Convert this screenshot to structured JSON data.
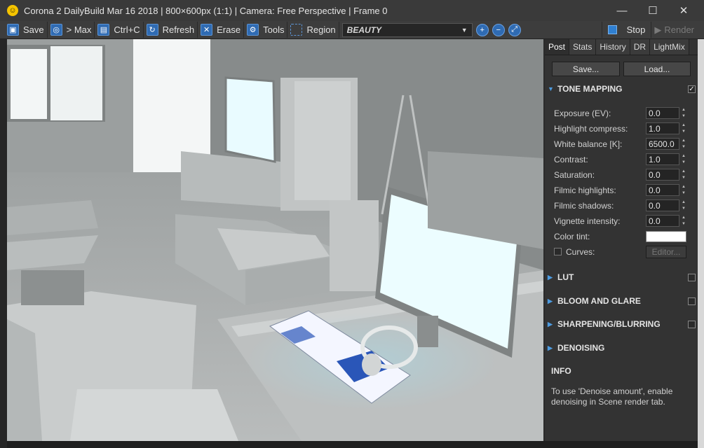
{
  "window": {
    "title": "Corona 2 DailyBuild Mar 16 2018 | 800×600px (1:1) | Camera: Free Perspective | Frame 0",
    "logo_glyph": "☺",
    "minimize": "—",
    "maximize": "☐",
    "close": "✕"
  },
  "toolbar": {
    "save": "Save",
    "max": "> Max",
    "copy": "Ctrl+C",
    "refresh": "Refresh",
    "erase": "Erase",
    "tools": "Tools",
    "region": "Region",
    "render_element": "BEAUTY",
    "stop": "Stop",
    "render": "Render",
    "icons": [
      "save-icon",
      "max-icon",
      "copy-icon",
      "refresh-icon",
      "erase-icon",
      "tools-icon",
      "region-icon",
      "zoom-in-icon",
      "zoom-out-icon",
      "zoom-fit-icon"
    ]
  },
  "panel": {
    "tabs": [
      "Post",
      "Stats",
      "History",
      "DR",
      "LightMix"
    ],
    "active_tab": "Post",
    "save_button": "Save...",
    "load_button": "Load...",
    "tone_mapping": {
      "title": "TONE MAPPING",
      "enabled": "✓",
      "exposure": {
        "label": "Exposure (EV):",
        "value": "0.0"
      },
      "highlight_compress": {
        "label": "Highlight compress:",
        "value": "1.0"
      },
      "white_balance": {
        "label": "White balance [K]:",
        "value": "6500.0"
      },
      "contrast": {
        "label": "Contrast:",
        "value": "1.0"
      },
      "saturation": {
        "label": "Saturation:",
        "value": "0.0"
      },
      "filmic_highlights": {
        "label": "Filmic highlights:",
        "value": "0.0"
      },
      "filmic_shadows": {
        "label": "Filmic shadows:",
        "value": "0.0"
      },
      "vignette": {
        "label": "Vignette intensity:",
        "value": "0.0"
      },
      "color_tint": {
        "label": "Color tint:",
        "color": "#ffffff"
      },
      "curves": {
        "label": "Curves:",
        "editor_button": "Editor..."
      }
    },
    "lut": "LUT",
    "bloom": "BLOOM AND GLARE",
    "sharpening": "SHARPENING/BLURRING",
    "denoising": "DENOISING",
    "info": {
      "title": "INFO",
      "text": "To use 'Denoise amount', enable denoising in Scene render tab."
    }
  },
  "colors": {
    "accent": "#2f6bb3",
    "panel_bg": "#333333",
    "titlebar": "#3a3a3a"
  }
}
